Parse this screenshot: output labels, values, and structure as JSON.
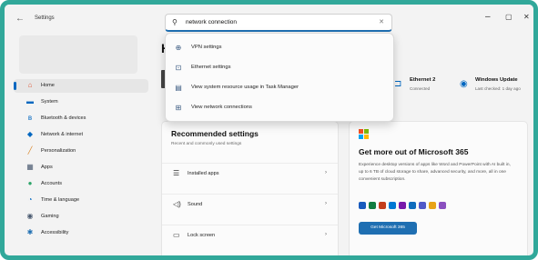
{
  "window": {
    "title": "Settings",
    "back_glyph": "←",
    "minimize_glyph": "–",
    "maximize_glyph": "▢",
    "close_glyph": "✕"
  },
  "search": {
    "query": "network connection",
    "icon": "search-icon",
    "clear_glyph": "✕"
  },
  "dropdown": {
    "items": [
      {
        "label": "VPN settings",
        "icon": "vpn-icon",
        "glyph": "⊕"
      },
      {
        "label": "Ethernet settings",
        "icon": "ethernet-icon",
        "glyph": "⊡"
      },
      {
        "label": "View system resource usage in Task Manager",
        "icon": "task-manager-icon",
        "glyph": "▤"
      },
      {
        "label": "View network connections",
        "icon": "network-connections-icon",
        "glyph": "⊞"
      }
    ]
  },
  "sidebar": {
    "items": [
      {
        "label": "Home",
        "icon": "home-icon",
        "glyph": "⌂",
        "color": "#e05a3a",
        "selected": true
      },
      {
        "label": "System",
        "icon": "system-icon",
        "glyph": "▬",
        "color": "#0067c0"
      },
      {
        "label": "Bluetooth & devices",
        "icon": "bluetooth-icon",
        "glyph": "ʙ",
        "color": "#0067c0"
      },
      {
        "label": "Network & internet",
        "icon": "network-icon",
        "glyph": "◆",
        "color": "#0067c0"
      },
      {
        "label": "Personalization",
        "icon": "brush-icon",
        "glyph": "╱",
        "color": "#d98324"
      },
      {
        "label": "Apps",
        "icon": "apps-icon",
        "glyph": "▦",
        "color": "#4a5a70"
      },
      {
        "label": "Accounts",
        "icon": "accounts-icon",
        "glyph": "●",
        "color": "#2ea56a"
      },
      {
        "label": "Time & language",
        "icon": "time-language-icon",
        "glyph": "◔",
        "color": "#0067c0"
      },
      {
        "label": "Gaming",
        "icon": "gaming-icon",
        "glyph": "◉",
        "color": "#4a5a70"
      },
      {
        "label": "Accessibility",
        "icon": "accessibility-icon",
        "glyph": "✱",
        "color": "#1f6fb2"
      }
    ]
  },
  "header": {
    "initial": "H"
  },
  "status_tiles": [
    {
      "title": "Ethernet 2",
      "subtitle": "Connected",
      "icon": "ethernet-icon",
      "glyph": "⊐"
    },
    {
      "title": "Windows Update",
      "subtitle": "Last checked: 1 day ago",
      "icon": "windows-update-icon",
      "glyph": "◉"
    }
  ],
  "recommended": {
    "title": "Recommended settings",
    "subtitle": "Recent and commonly used settings",
    "rows": [
      {
        "label": "Installed apps",
        "icon": "installed-apps-icon",
        "glyph": "☰"
      },
      {
        "label": "Sound",
        "icon": "sound-icon",
        "glyph": "◁)"
      },
      {
        "label": "Lock screen",
        "icon": "lock-screen-icon",
        "glyph": "▭"
      }
    ],
    "chevron": "›"
  },
  "m365": {
    "title": "Get more out of Microsoft 365",
    "body": "Experience desktop versions of apps like Word and PowerPoint with AI built in, up to 6 TB of cloud storage to share, advanced security, and more, all in one convenient subscription.",
    "button": "Get Microsoft 365",
    "logo_colors": [
      "#f25022",
      "#7fba00",
      "#00a4ef",
      "#ffb900"
    ],
    "app_colors": [
      "#185abd",
      "#107c41",
      "#c43e1c",
      "#0078d4",
      "#7719aa",
      "#0f6cbd",
      "#5059c9",
      "#e8a317",
      "#8a4fbf"
    ]
  }
}
